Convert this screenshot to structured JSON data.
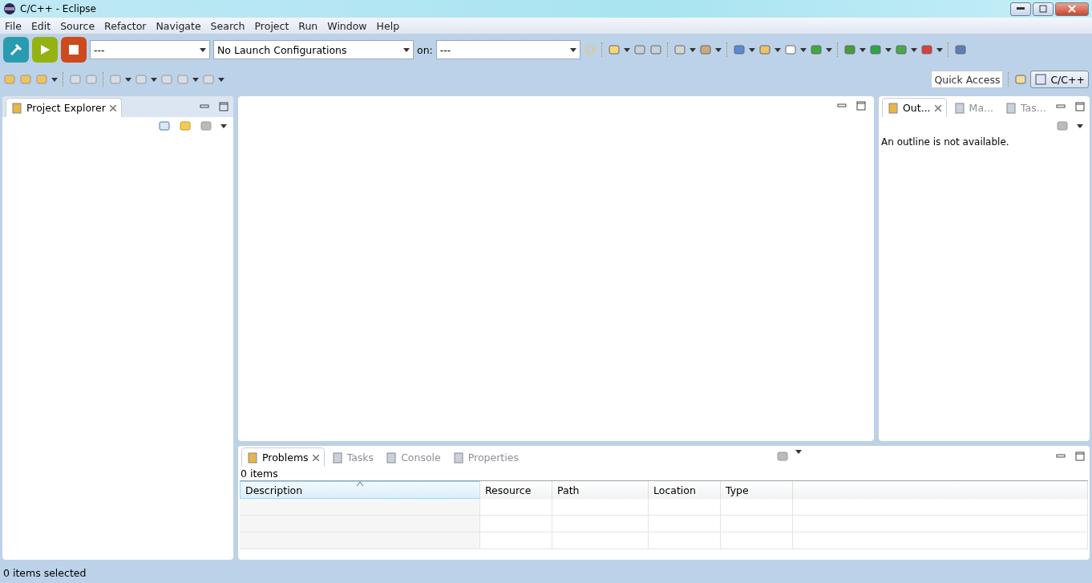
{
  "window": {
    "title": "C/C++ - Eclipse"
  },
  "menu": [
    "File",
    "Edit",
    "Source",
    "Refactor",
    "Navigate",
    "Search",
    "Project",
    "Run",
    "Window",
    "Help"
  ],
  "launch_bar": {
    "mode": "---",
    "configuration": "No Launch Configurations",
    "target_label": "on:",
    "target": "---"
  },
  "quick_access": {
    "placeholder": "Quick Access"
  },
  "perspective": {
    "label": "C/C++",
    "selected": true
  },
  "left_panel": {
    "tabs": [
      {
        "label": "Project Explorer",
        "selected": true
      }
    ]
  },
  "outline_panel": {
    "tabs": [
      {
        "label": "Out...",
        "selected": true
      },
      {
        "label": "Ma...",
        "selected": false
      },
      {
        "label": "Tas...",
        "selected": false
      }
    ],
    "message": "An outline is not available."
  },
  "bottom_panel": {
    "tabs": [
      {
        "label": "Problems",
        "selected": true
      },
      {
        "label": "Tasks",
        "selected": false
      },
      {
        "label": "Console",
        "selected": false
      },
      {
        "label": "Properties",
        "selected": false
      }
    ],
    "summary": "0 items",
    "columns": [
      {
        "label": "Description",
        "sorted": true
      },
      {
        "label": "Resource",
        "sorted": false
      },
      {
        "label": "Path",
        "sorted": false
      },
      {
        "label": "Location",
        "sorted": false
      },
      {
        "label": "Type",
        "sorted": false
      }
    ]
  },
  "status_bar": {
    "text": "0 items selected"
  }
}
